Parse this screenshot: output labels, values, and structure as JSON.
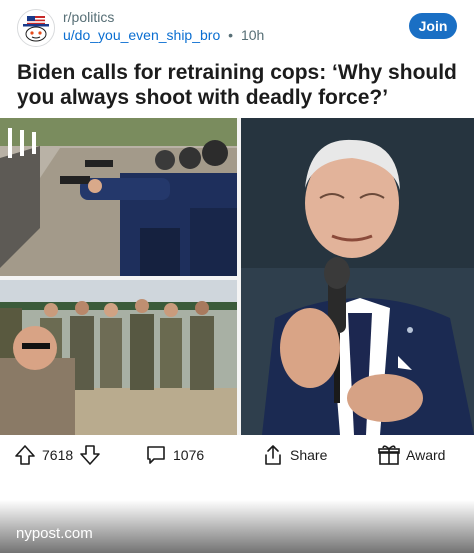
{
  "post": {
    "subreddit": "r/politics",
    "author": "u/do_you_even_ship_bro",
    "separator": "•",
    "age": "10h",
    "join_label": "Join",
    "title": "Biden calls for retraining cops: ‘Why should you always shoot with deadly force?’",
    "source": "nypost.com"
  },
  "actions": {
    "upvotes": "7618",
    "comments": "1076",
    "share_label": "Share",
    "award_label": "Award"
  },
  "colors": {
    "join_button": "#1a6fc4",
    "author_link": "#0a6ed1",
    "meta_text": "#576f76"
  },
  "icons": [
    "subreddit-avatar-icon",
    "upvote-icon",
    "downvote-icon",
    "comment-icon",
    "share-icon",
    "award-icon"
  ]
}
